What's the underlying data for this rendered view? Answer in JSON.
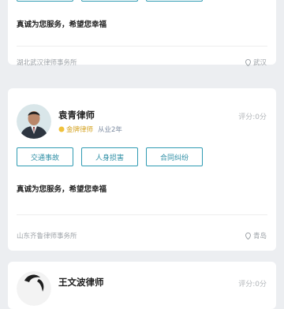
{
  "cards": [
    {
      "tags": [
        "",
        "",
        ""
      ],
      "motto": "真诚为您服务，希望您幸福",
      "firm": "湖北武汉律师事务所",
      "location": "武汉"
    },
    {
      "name": "袁青律师",
      "score": "评分:0分",
      "badge": "金牌律师",
      "years": "从业2年",
      "tags": [
        "交通事故",
        "人身损害",
        "合同纠纷"
      ],
      "motto": "真诚为您服务，希望您幸福",
      "firm": "山东齐鲁律师事务所",
      "location": "青岛"
    },
    {
      "name": "王文波律师",
      "score": "评分:0分"
    }
  ],
  "colors": {
    "accent": "#2f9bb2",
    "gold": "#d4a21f",
    "muted": "#9ea3a8"
  }
}
